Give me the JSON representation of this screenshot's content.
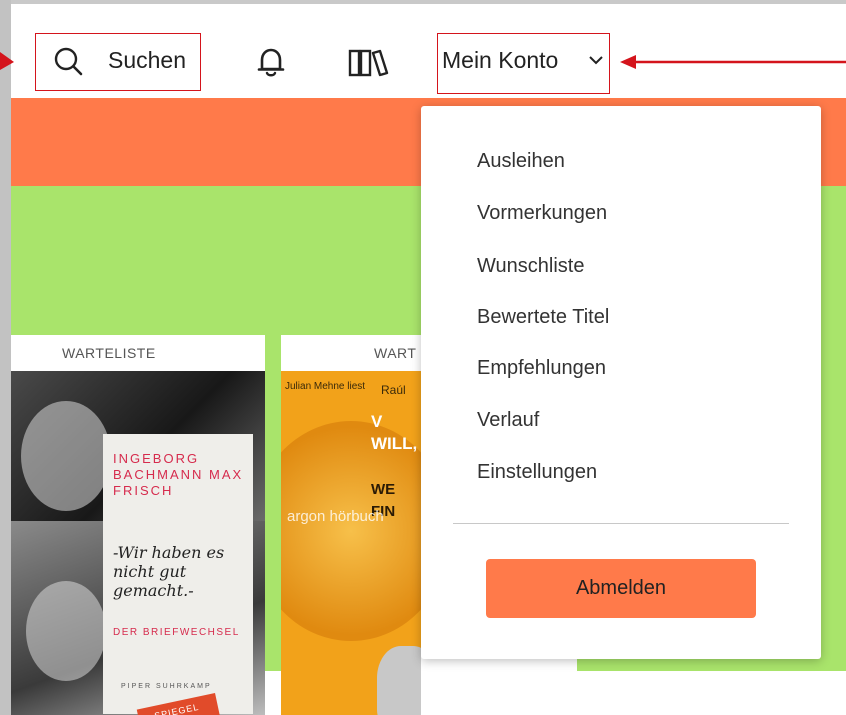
{
  "header": {
    "search_label": "Suchen",
    "account_label": "Mein Konto"
  },
  "account_menu": {
    "items": [
      {
        "label": "Ausleihen"
      },
      {
        "label": "Vormerkungen"
      },
      {
        "label": "Wunschliste"
      },
      {
        "label": "Bewertete Titel"
      },
      {
        "label": "Empfehlungen"
      },
      {
        "label": "Verlauf"
      },
      {
        "label": "Einstellungen"
      }
    ],
    "logout_label": "Abmelden"
  },
  "cards": [
    {
      "tag": "WARTELISTE",
      "cover": {
        "names": "INGEBORG BACHMANN MAX FRISCH",
        "quote": "-Wir haben es nicht gut gemacht.-",
        "subtitle": "DER BRIEFWECHSEL",
        "publishers": "PIPER SUHRKAMP",
        "badge": "SPIEGEL"
      }
    },
    {
      "tag": "WART",
      "cover": {
        "reader": "Julian Mehne liest",
        "author": "Raúl",
        "title_1": "V WILL,",
        "title_2": "WE FIN",
        "label": "argon hörbuch"
      }
    }
  ],
  "colors": {
    "accent_orange": "#ff7a4a",
    "banner_green": "#a9e46b",
    "annotation_red": "#d4141c"
  },
  "icons": {
    "search": "search-icon",
    "notifications": "bell-icon",
    "library": "library-icon",
    "dropdown": "chevron-down-icon"
  }
}
